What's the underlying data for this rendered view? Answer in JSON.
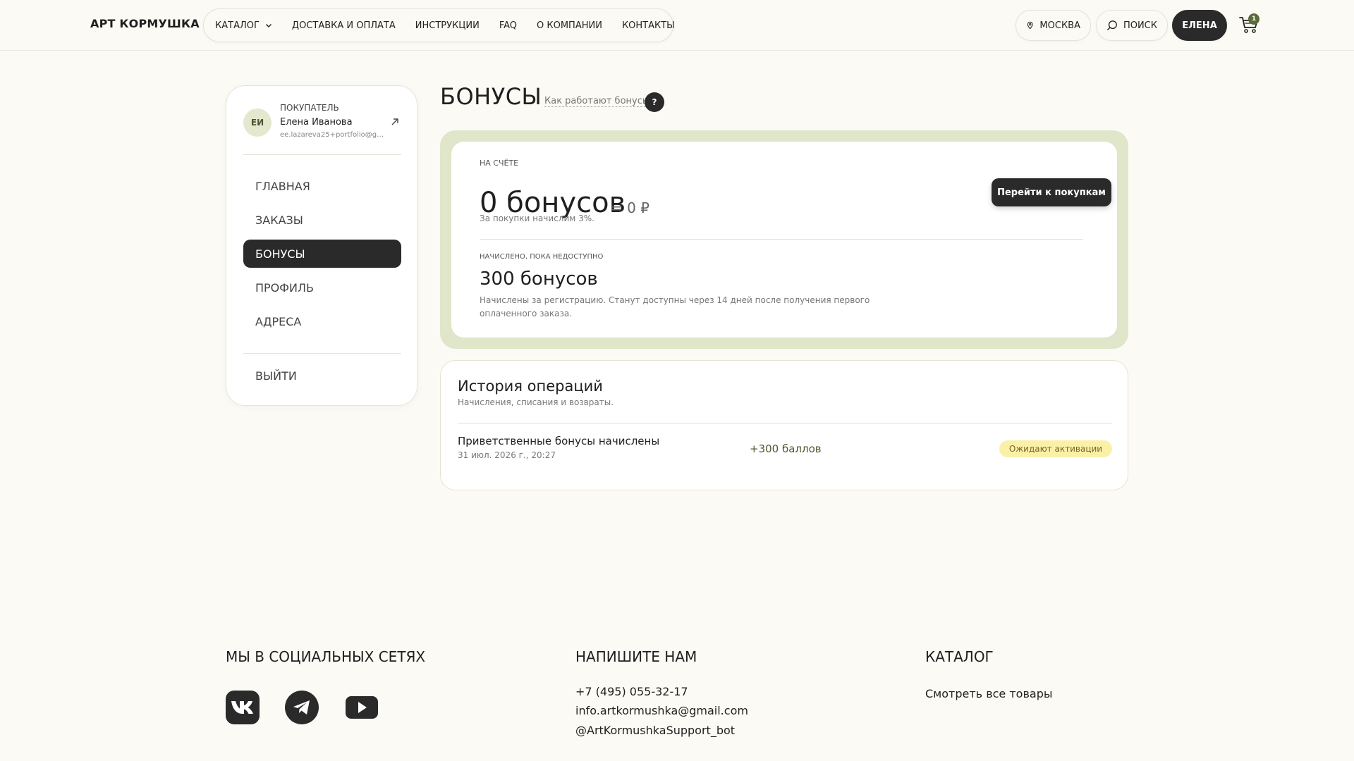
{
  "header": {
    "logo": "АРТ КОРМУШКА",
    "nav": [
      "КАТАЛОГ",
      "ДОСТАВКА И ОПЛАТА",
      "ИНСТРУКЦИИ",
      "FAQ",
      "О КОМПАНИИ",
      "КОНТАКТЫ"
    ],
    "city": "МОСКВА",
    "search": "ПОИСК",
    "user": "ЕЛЕНА",
    "cart_count": "1"
  },
  "sidebar": {
    "initials": "ЕИ",
    "role": "ПОКУПАТЕЛЬ",
    "name": "Елена Иванова",
    "email": "ee.lazareva25+portfolio@gm...",
    "items": [
      "ГЛАВНАЯ",
      "ЗАКАЗЫ",
      "БОНУСЫ",
      "ПРОФИЛЬ",
      "АДРЕСА"
    ],
    "active": "БОНУСЫ",
    "logout": "ВЫЙТИ"
  },
  "main": {
    "title": "БОНУСЫ",
    "how_link": "Как работают бонусы",
    "help": "?"
  },
  "balance": {
    "label": "НА СЧЁТЕ",
    "amount": "0 бонусов",
    "rub": "= 0 ₽",
    "note": "За покупки начислим 3%.",
    "button": "Перейти к покупкам",
    "pending_label": "НАЧИСЛЕНО, ПОКА НЕДОСТУПНО",
    "pending_amount": "300 бонусов",
    "pending_note_1": "Начислены за регистрацию. Станут доступны через 14 дней после получения первого",
    "pending_note_2": "оплаченного заказа."
  },
  "history": {
    "title": "История операций",
    "subtitle": "Начисления, списания и возвраты.",
    "rows": [
      {
        "title": "Приветственные бонусы начислены",
        "date": "31 июл. 2026 г., 20:27",
        "amount": "+300 баллов",
        "status": "Ожидают активации"
      }
    ]
  },
  "footer": {
    "social_title": "МЫ В СОЦИАЛЬНЫХ СЕТЯХ",
    "social_icons": [
      "vk-icon",
      "telegram-icon",
      "youtube-icon"
    ],
    "contact_title": "НАПИШИТЕ НАМ",
    "phone": "+7 (495) 055-32-17",
    "email": "info.artkormushka@gmail.com",
    "telegram": "@ArtKormushkaSupport_bot",
    "catalog_title": "КАТАЛОГ",
    "catalog_link": "Смотреть все товары"
  },
  "colors": {
    "accent_dark": "#2a2a2a",
    "balance_frame": "#dfe6c9",
    "status_badge": "#fbf0a8",
    "page_bg": "#fcfaf4"
  }
}
